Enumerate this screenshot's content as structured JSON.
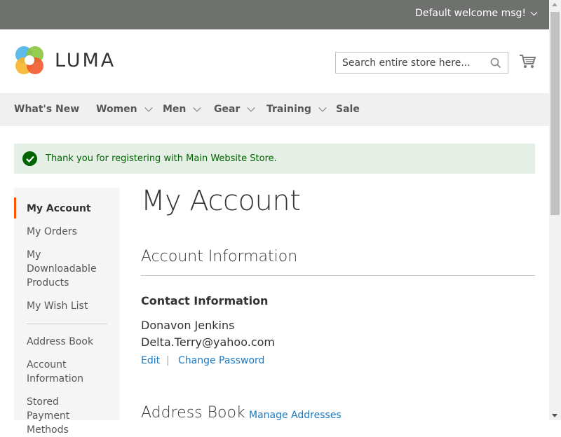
{
  "topbar": {
    "welcome": "Default welcome msg!"
  },
  "header": {
    "logo_text": "LUMA",
    "search_placeholder": "Search entire store here...",
    "colors": {
      "topbar": "#6e716e",
      "accent": "#ff5501",
      "link": "#1979c3",
      "success": "#006400"
    }
  },
  "nav": {
    "items": [
      {
        "label": "What's New"
      },
      {
        "label": "Women"
      },
      {
        "label": "Men"
      },
      {
        "label": "Gear"
      },
      {
        "label": "Training"
      },
      {
        "label": "Sale"
      }
    ]
  },
  "message": {
    "text": "Thank you for registering with Main Website Store."
  },
  "sidebar": {
    "items": [
      {
        "label": "My Account"
      },
      {
        "label": "My Orders"
      },
      {
        "label": "My Downloadable Products"
      },
      {
        "label": "My Wish List"
      },
      {
        "label": "Address Book"
      },
      {
        "label": "Account Information"
      },
      {
        "label": "Stored Payment Methods"
      }
    ]
  },
  "main": {
    "title": "My Account",
    "account_info": {
      "title": "Account Information",
      "contact_title": "Contact Information",
      "name": "Donavon Jenkins",
      "email": "Delta.Terry@yahoo.com",
      "edit_label": "Edit",
      "separator": "|",
      "change_password_label": "Change Password"
    },
    "address_book": {
      "title": "Address Book",
      "manage_label": "Manage Addresses"
    }
  }
}
